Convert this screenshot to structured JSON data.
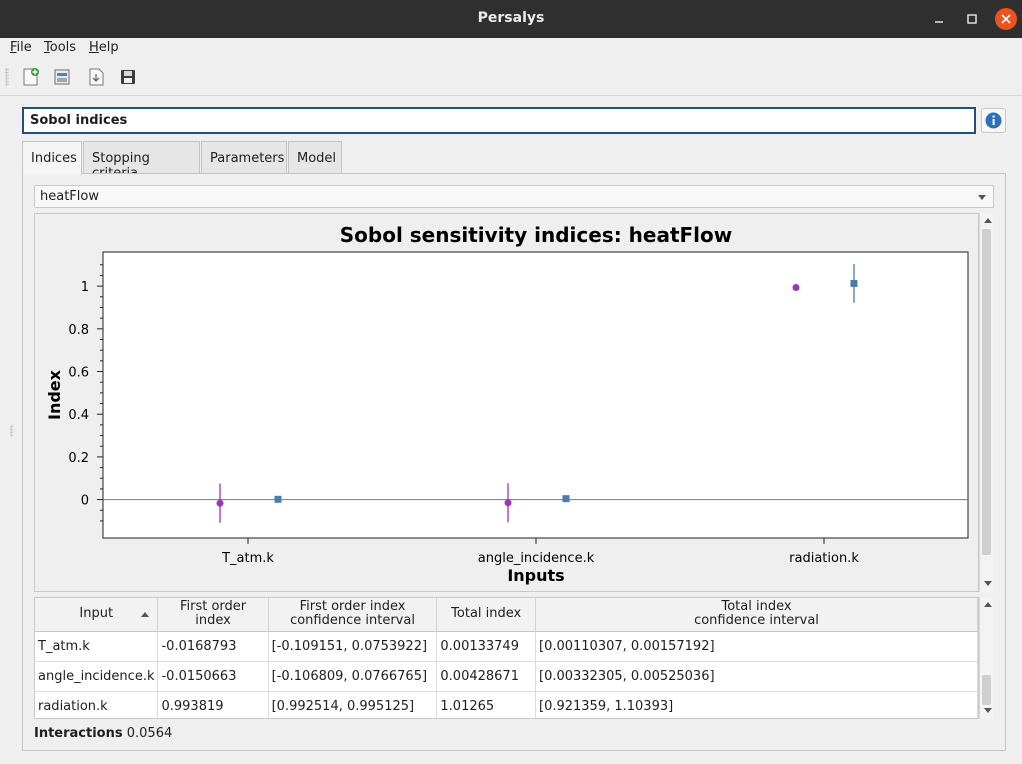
{
  "window": {
    "title": "Persalys"
  },
  "menu": {
    "items": [
      "File",
      "Tools",
      "Help"
    ]
  },
  "toolbar": {
    "icons": [
      "new-study-icon",
      "open-study-icon",
      "import-python-icon",
      "save-icon"
    ]
  },
  "analysis": {
    "name": "Sobol indices"
  },
  "tabs": [
    "Indices",
    "Stopping criteria",
    "Parameters",
    "Model"
  ],
  "output_select": {
    "value": "heatFlow"
  },
  "chart_data": {
    "type": "scatter",
    "title": "Sobol sensitivity indices: heatFlow",
    "xlabel": "Inputs",
    "ylabel": "Index",
    "categories": [
      "T_atm.k",
      "angle_incidence.k",
      "radiation.k"
    ],
    "yticks": [
      "1",
      "0.8",
      "0.6",
      "0.4",
      "0.2",
      "0"
    ],
    "ylim": [
      -0.18,
      1.16
    ],
    "series": [
      {
        "kind": "first_order",
        "color": "#9b36b6",
        "marker": "circle",
        "values": [
          -0.0168793,
          -0.0150663,
          0.993819
        ],
        "ci_low": [
          -0.109151,
          -0.106809,
          0.992514
        ],
        "ci_high": [
          0.0753922,
          0.0766765,
          0.995125
        ]
      },
      {
        "kind": "total",
        "color": "#4a7ea8",
        "marker": "square",
        "values": [
          0.00133749,
          0.00428671,
          1.01265
        ],
        "ci_low": [
          0.00110307,
          0.00332305,
          0.921359
        ],
        "ci_high": [
          0.00157192,
          0.00525036,
          1.10393
        ]
      }
    ],
    "grid": false,
    "zero_line": true
  },
  "table": {
    "headers": [
      "Input",
      "First order\nindex",
      "First order index\nconfidence interval",
      "Total index",
      "Total index\nconfidence interval"
    ],
    "rows": [
      [
        "T_atm.k",
        "-0.0168793",
        "[-0.109151, 0.0753922]",
        "0.00133749",
        "[0.00110307, 0.00157192]"
      ],
      [
        "angle_incidence.k",
        "-0.0150663",
        "[-0.106809, 0.0766765]",
        "0.00428671",
        "[0.00332305, 0.00525036]"
      ],
      [
        "radiation.k",
        "0.993819",
        "[0.992514, 0.995125]",
        "1.01265",
        "[0.921359, 1.10393]"
      ]
    ]
  },
  "interactions": {
    "label": "Interactions",
    "value": "0.0564"
  }
}
